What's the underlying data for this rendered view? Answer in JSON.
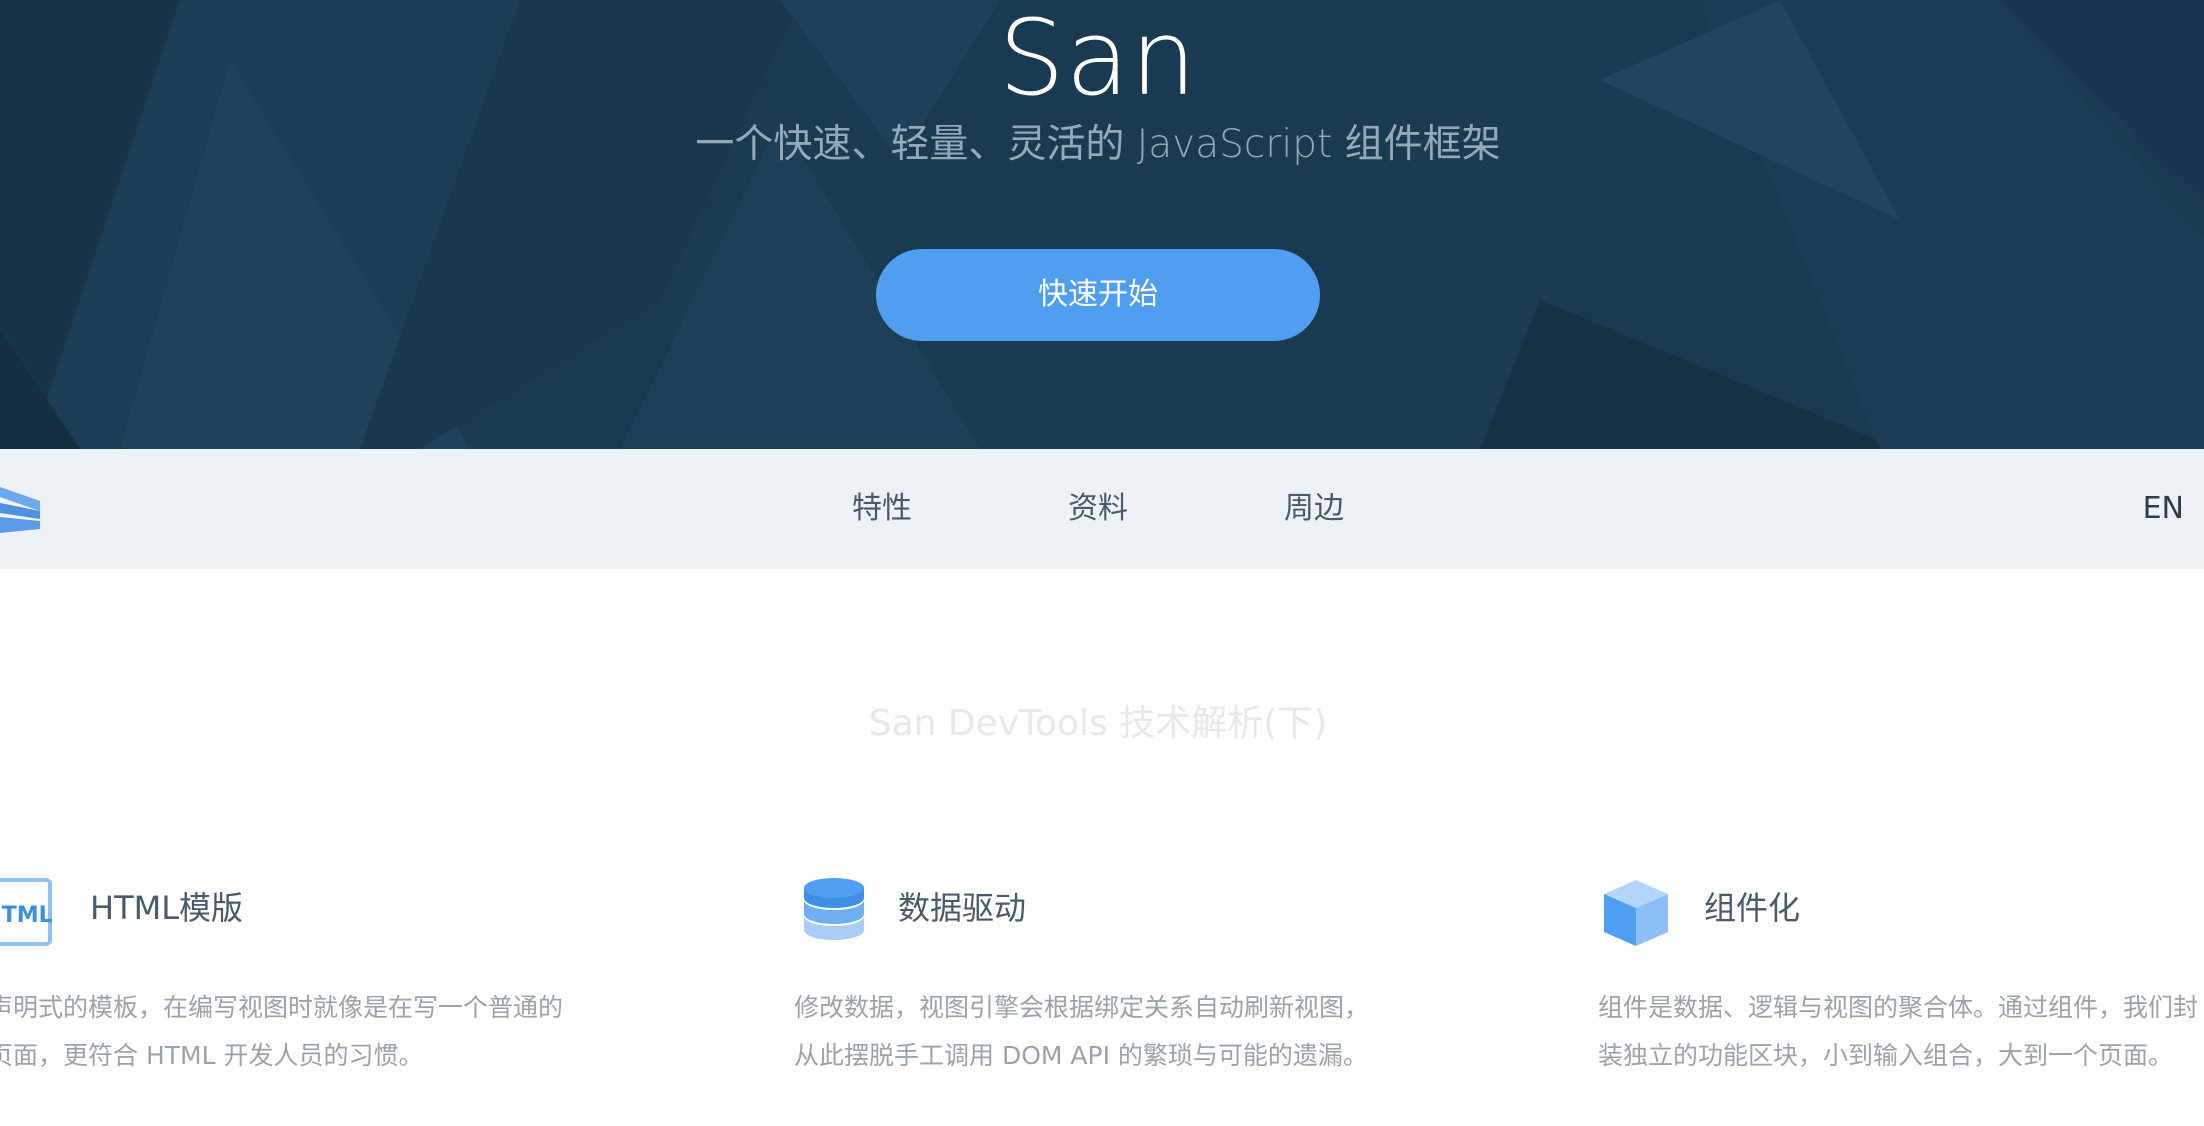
{
  "hero": {
    "title": "San",
    "subtitle": "一个快速、轻量、灵活的 JavaScript 组件框架",
    "cta_label": "快速开始"
  },
  "nav": {
    "logo_icon": "san-logo-icon",
    "items": [
      {
        "label": "特性"
      },
      {
        "label": "资料"
      },
      {
        "label": "周边"
      }
    ],
    "lang_label": "EN"
  },
  "headline": {
    "text": "San DevTools 技术解析(下)"
  },
  "features": [
    {
      "icon": "html-icon",
      "title": "HTML模版",
      "desc": "声明式的模板，在编写视图时就像是在写一个普通的页面，更符合 HTML 开发人员的习惯。"
    },
    {
      "icon": "database-icon",
      "title": "数据驱动",
      "desc": "修改数据，视图引擎会根据绑定关系自动刷新视图，从此摆脱手工调用 DOM API 的繁琐与可能的遗漏。"
    },
    {
      "icon": "cube-icon",
      "title": "组件化",
      "desc": "组件是数据、逻辑与视图的聚合体。通过组件，我们封装独立的功能区块，小到输入组合，大到一个页面。"
    }
  ],
  "colors": {
    "hero_bg": "#1a3a52",
    "accent": "#4f9ef0",
    "nav_bg": "#eef2f7"
  }
}
